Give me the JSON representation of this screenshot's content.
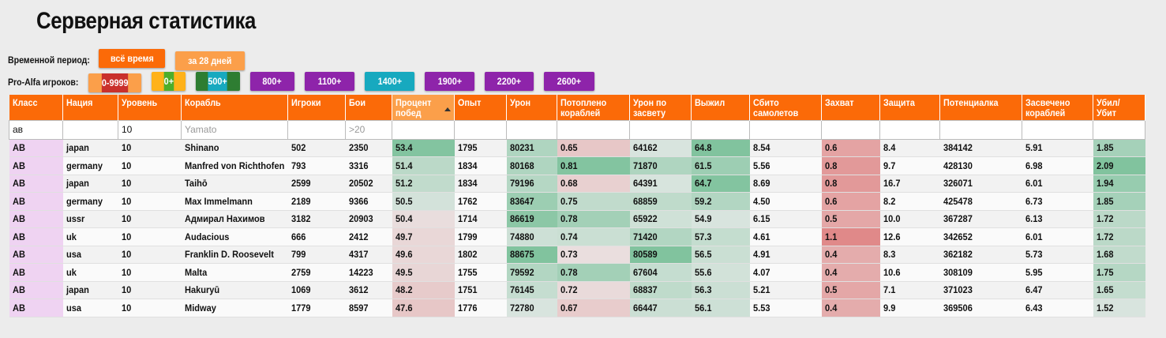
{
  "page": {
    "title": "Серверная статистика"
  },
  "period": {
    "label": "Временной период:",
    "buttons": [
      {
        "label": "всё время",
        "color": "#fb6a08",
        "active": true
      },
      {
        "label": "за 28 дней",
        "color": "#fb9f4a",
        "active": false
      }
    ]
  },
  "pro": {
    "label": "Pro-Alfa игроков:",
    "buttons": [
      {
        "label": "0-9999",
        "color": "#fb9f4a"
      },
      {
        "label": "0+",
        "color": "#c9302c"
      },
      {
        "label": "500+",
        "color": "#ffb21a"
      },
      {
        "label": "800+",
        "color": "#4cae2c"
      },
      {
        "label": "1100+",
        "color": "#2e7d32"
      },
      {
        "label": "1400+",
        "color": "#17a9bf"
      },
      {
        "label": "1900+",
        "color": "#8e24aa"
      },
      {
        "label": "2200+",
        "color": "#8e24aa"
      },
      {
        "label": "2600+",
        "color": "#8e24aa"
      }
    ]
  },
  "table": {
    "columns": [
      "Класс",
      "Нация",
      "Уровень",
      "Корабль",
      "Игроки",
      "Бои",
      "Процент побед",
      "Опыт",
      "Урон",
      "Потоплено кораблей",
      "Урон по засвету",
      "Выжил",
      "Сбито самолетов",
      "Захват",
      "Защита",
      "Потенциалка",
      "Засвечено кораблей",
      "Убил/ Убит"
    ],
    "sorted_column": "Процент побед",
    "filters": {
      "class": "ав",
      "level": "10",
      "ship_placeholder": "Yamato",
      "battles_placeholder": ">20"
    },
    "rows": [
      [
        "АВ",
        "japan",
        "10",
        "Shinano",
        "502",
        "2350",
        "53.4",
        "1795",
        "80231",
        "0.65",
        "64162",
        "64.8",
        "8.54",
        "0.6",
        "8.4",
        "384142",
        "5.91",
        "1.85"
      ],
      [
        "АВ",
        "germany",
        "10",
        "Manfred von Richthofen",
        "793",
        "3316",
        "51.4",
        "1834",
        "80168",
        "0.81",
        "71870",
        "61.5",
        "5.56",
        "0.8",
        "9.7",
        "428130",
        "6.98",
        "2.09"
      ],
      [
        "АВ",
        "japan",
        "10",
        "Taihō",
        "2599",
        "20502",
        "51.2",
        "1834",
        "79196",
        "0.68",
        "64391",
        "64.7",
        "8.69",
        "0.8",
        "16.7",
        "326071",
        "6.01",
        "1.94"
      ],
      [
        "АВ",
        "germany",
        "10",
        "Max Immelmann",
        "2189",
        "9366",
        "50.5",
        "1762",
        "83647",
        "0.75",
        "68859",
        "59.2",
        "4.50",
        "0.6",
        "8.2",
        "425478",
        "6.73",
        "1.85"
      ],
      [
        "АВ",
        "ussr",
        "10",
        "Адмирал Нахимов",
        "3182",
        "20903",
        "50.4",
        "1714",
        "86619",
        "0.78",
        "65922",
        "54.9",
        "6.15",
        "0.5",
        "10.0",
        "367287",
        "6.13",
        "1.72"
      ],
      [
        "АВ",
        "uk",
        "10",
        "Audacious",
        "666",
        "2412",
        "49.7",
        "1799",
        "74880",
        "0.74",
        "71420",
        "57.3",
        "4.61",
        "1.1",
        "12.6",
        "342652",
        "6.01",
        "1.72"
      ],
      [
        "АВ",
        "usa",
        "10",
        "Franklin D. Roosevelt",
        "799",
        "4317",
        "49.6",
        "1802",
        "88675",
        "0.73",
        "80589",
        "56.5",
        "4.91",
        "0.4",
        "8.3",
        "362182",
        "5.73",
        "1.68"
      ],
      [
        "АВ",
        "uk",
        "10",
        "Malta",
        "2759",
        "14223",
        "49.5",
        "1755",
        "79592",
        "0.78",
        "67604",
        "55.6",
        "4.07",
        "0.4",
        "10.6",
        "308109",
        "5.95",
        "1.75"
      ],
      [
        "АВ",
        "japan",
        "10",
        "Hakuryū",
        "1069",
        "3612",
        "48.2",
        "1751",
        "76145",
        "0.72",
        "68837",
        "56.3",
        "5.21",
        "0.5",
        "7.1",
        "371023",
        "6.47",
        "1.65"
      ],
      [
        "АВ",
        "usa",
        "10",
        "Midway",
        "1779",
        "8597",
        "47.6",
        "1776",
        "72780",
        "0.67",
        "66447",
        "56.1",
        "5.53",
        "0.4",
        "9.9",
        "369506",
        "6.43",
        "1.52"
      ]
    ]
  }
}
